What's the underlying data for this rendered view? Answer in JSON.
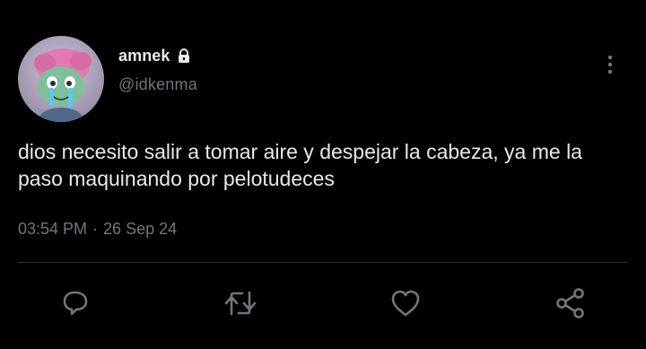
{
  "author": {
    "display_name": "amnek",
    "handle": "@idkenma",
    "avatar_icon": "cartoon-character-avatar",
    "protected_icon": "lock-icon"
  },
  "tweet": {
    "text": "dios necesito salir a tomar aire y despejar la cabeza, ya me la paso maquinando por pelotudeces",
    "time": "03:54 PM",
    "separator": "·",
    "date": "26 Sep 24"
  },
  "actions": {
    "reply_icon": "reply-icon",
    "retweet_icon": "retweet-icon",
    "like_icon": "heart-icon",
    "share_icon": "share-icon"
  },
  "colors": {
    "background": "#000000",
    "primary_text": "#e7e9ea",
    "secondary_text": "#71767b",
    "divider": "#2f3336"
  }
}
